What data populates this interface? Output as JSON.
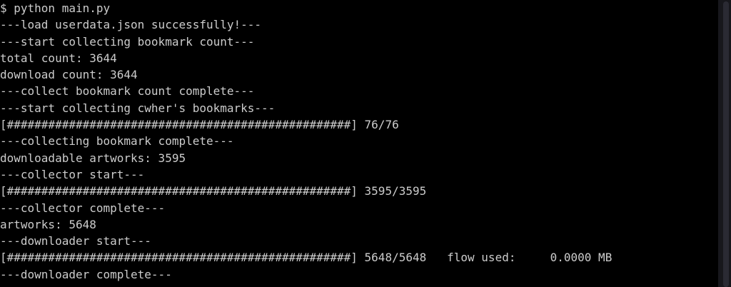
{
  "terminal": {
    "lines": [
      "$ python main.py",
      "---load userdata.json successfully!---",
      "---start collecting bookmark count---",
      "total count: 3644",
      "download count: 3644",
      "---collect bookmark count complete---",
      "---start collecting cwher's bookmarks---",
      "[##################################################] 76/76",
      "---collecting bookmark complete---",
      "downloadable artworks: 3595",
      "---collector start---",
      "[##################################################] 3595/3595",
      "---collector complete---",
      "artworks: 5648",
      "---downloader start---",
      "[##################################################] 5648/5648   flow used:     0.0000 MB",
      "---downloader complete---"
    ]
  },
  "colors": {
    "background": "#000000",
    "text": "#cccccc",
    "scrollbar": "#17171c"
  }
}
